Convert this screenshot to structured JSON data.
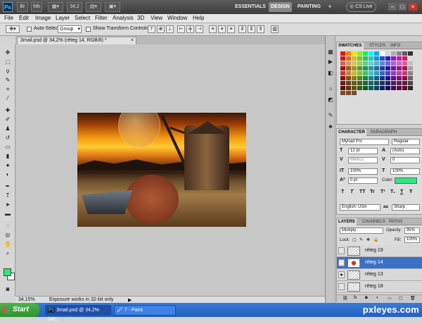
{
  "appbar": {
    "logo": "Ps",
    "zoom": "34,2",
    "workspaces": [
      "ESSENTIALS",
      "DESIGN",
      "PAINTING"
    ],
    "active_workspace": "DESIGN",
    "more": "»",
    "cslive": "CS Live",
    "win_min": "–",
    "win_max": "□",
    "win_close": "×"
  },
  "menu": [
    "File",
    "Edit",
    "Image",
    "Layer",
    "Select",
    "Filter",
    "Analysis",
    "3D",
    "View",
    "Window",
    "Help"
  ],
  "options": {
    "auto_select_label": "Auto-Select:",
    "auto_select_value": "Group",
    "show_transform": "Show Transform Controls"
  },
  "document_tab": {
    "title": "3mail.psd @ 34,2% (réteg 14, RGB/8) *",
    "close": "×"
  },
  "status": {
    "zoom": "34,15%",
    "message": "Exposure works in 32-bit only",
    "arrow": "▶"
  },
  "swatches_panel": {
    "tabs": [
      "SWATCHES",
      "STYLES",
      "INFO"
    ]
  },
  "character_panel": {
    "tabs": [
      "CHARACTER",
      "PARAGRAPH"
    ],
    "font": "Myriad Pro",
    "style": "Regular",
    "size": "12 pt",
    "leading": "(Auto)",
    "kerning": "Metrics",
    "tracking": "0",
    "vscale": "100%",
    "hscale": "100%",
    "baseline": "0 pt",
    "color_label": "Color:",
    "color": "#2ee87a",
    "language": "English: USA",
    "aa_prefix": "aa",
    "antialias": "Sharp",
    "styles": [
      "T",
      "T",
      "TT",
      "Tr",
      "T¹",
      "T₁",
      "T",
      "Ŧ"
    ]
  },
  "layers_panel": {
    "tabs": [
      "LAYERS",
      "CHANNELS",
      "PATHS"
    ],
    "blend": "Multiply",
    "opacity_label": "Opacity:",
    "opacity": "95%",
    "lock_label": "Lock:",
    "fill_label": "Fill:",
    "fill": "100%",
    "layers": [
      {
        "name": "réteg 19",
        "visible": false,
        "selected": false
      },
      {
        "name": "réteg 14",
        "visible": true,
        "selected": true
      },
      {
        "name": "réteg 13",
        "visible": true,
        "selected": false
      },
      {
        "name": "réteg 18",
        "visible": false,
        "selected": false
      }
    ]
  },
  "taskbar": {
    "start": "Start",
    "items": [
      "3mail.psd @ 34,2% (rét...",
      "7 - Paint"
    ]
  },
  "watermark": "pxleyes.com"
}
